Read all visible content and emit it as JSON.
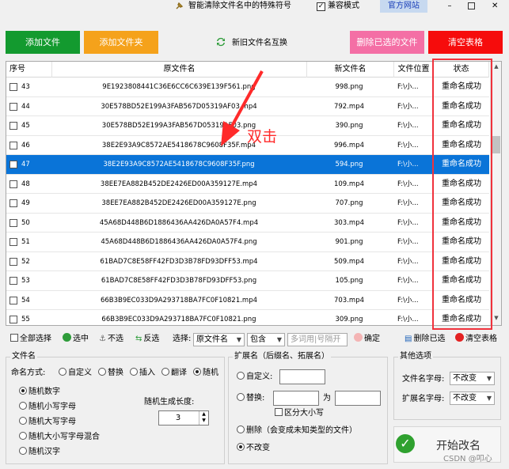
{
  "titlebar": {
    "app_title": "智能清除文件名中的特殊符号",
    "compat_label": "兼容模式",
    "official_site": "官方网站",
    "min": "–",
    "close": "✕"
  },
  "toolbar": {
    "add_file": "添加文件",
    "add_folder": "添加文件夹",
    "swap_names": "新旧文件名互换",
    "delete_selected": "删除已选的文件",
    "clear_table": "清空表格"
  },
  "table": {
    "headers": [
      "序号",
      "原文件名",
      "新文件名",
      "文件位置",
      "状态"
    ],
    "rows": [
      {
        "num": "43",
        "orig": "9E1923808441C36E6CC6C639E139F561.png",
        "new": "998.png",
        "loc": "F:\\小...",
        "status": "重命名成功"
      },
      {
        "num": "44",
        "orig": "30E578BD52E199A3FAB567D05319AF03.mp4",
        "new": "792.mp4",
        "loc": "F:\\小...",
        "status": "重命名成功"
      },
      {
        "num": "45",
        "orig": "30E578BD52E199A3FAB567D05319AF03.png",
        "new": "390.png",
        "loc": "F:\\小...",
        "status": "重命名成功"
      },
      {
        "num": "46",
        "orig": "38E2E93A9C8572AE5418678C9608F35F.mp4",
        "new": "996.mp4",
        "loc": "F:\\小...",
        "status": "重命名成功"
      },
      {
        "num": "47",
        "orig": "38E2E93A9C8572AE5418678C9608F35F.png",
        "new": "594.png",
        "loc": "F:\\小...",
        "status": "重命名成功"
      },
      {
        "num": "48",
        "orig": "38EE7EA882B452DE2426ED00A359127E.mp4",
        "new": "109.mp4",
        "loc": "F:\\小...",
        "status": "重命名成功"
      },
      {
        "num": "49",
        "orig": "38EE7EA882B452DE2426ED00A359127E.png",
        "new": "707.png",
        "loc": "F:\\小...",
        "status": "重命名成功"
      },
      {
        "num": "50",
        "orig": "45A68D448B6D1886436AA426DA0A57F4.mp4",
        "new": "303.mp4",
        "loc": "F:\\小...",
        "status": "重命名成功"
      },
      {
        "num": "51",
        "orig": "45A68D448B6D1886436AA426DA0A57F4.png",
        "new": "901.png",
        "loc": "F:\\小...",
        "status": "重命名成功"
      },
      {
        "num": "52",
        "orig": "61BAD7C8E58FF42FD3D3B78FD93DFF53.mp4",
        "new": "509.mp4",
        "loc": "F:\\小...",
        "status": "重命名成功"
      },
      {
        "num": "53",
        "orig": "61BAD7C8E58FF42FD3D3B78FD93DFF53.png",
        "new": "105.png",
        "loc": "F:\\小...",
        "status": "重命名成功"
      },
      {
        "num": "54",
        "orig": "66B3B9EC033D9A293718BA7FC0F10821.mp4",
        "new": "703.mp4",
        "loc": "F:\\小...",
        "status": "重命名成功"
      },
      {
        "num": "55",
        "orig": "66B3B9EC033D9A293718BA7FC0F10821.png",
        "new": "309.png",
        "loc": "F:\\小...",
        "status": "重命名成功"
      }
    ],
    "selected_num": "47"
  },
  "annotation": {
    "text": "双击",
    "color": "#ff2a2a"
  },
  "selection_bar": {
    "select_all": "全部选择",
    "select": "选中",
    "unselect": "不选",
    "invert": "反选",
    "select_label": "选择:",
    "field_dropdown": "原文件名",
    "match_dropdown": "包含",
    "filter_placeholder": "多词用|号隔开",
    "confirm": "确定",
    "delete_selected": "删除已选",
    "clear_table": "清空表格"
  },
  "filename_group": {
    "title": "文件名",
    "method_label": "命名方式:",
    "methods": [
      "自定义",
      "替换",
      "插入",
      "翻译",
      "随机"
    ],
    "selected_method": "随机",
    "random_options": [
      "随机数字",
      "随机小写字母",
      "随机大写字母",
      "随机大小写字母混合",
      "随机汉字"
    ],
    "selected_random": "随机数字",
    "length_label": "随机生成长度:",
    "length_value": "3"
  },
  "ext_group": {
    "title": "扩展名（后缀名、拓展名）",
    "custom": "自定义:",
    "replace": "替换:",
    "to": "为",
    "case_sensitive": "区分大小写",
    "delete": "删除（会变成未知类型的文件）",
    "no_change": "不改变",
    "selected": "不改变"
  },
  "other_group": {
    "title": "其他选项",
    "filename_case_label": "文件名字母:",
    "filename_case_value": "不改变",
    "ext_case_label": "扩展名字母:",
    "ext_case_value": "不改变"
  },
  "start": {
    "label": "开始改名"
  },
  "watermark": "CSDN @叩心"
}
